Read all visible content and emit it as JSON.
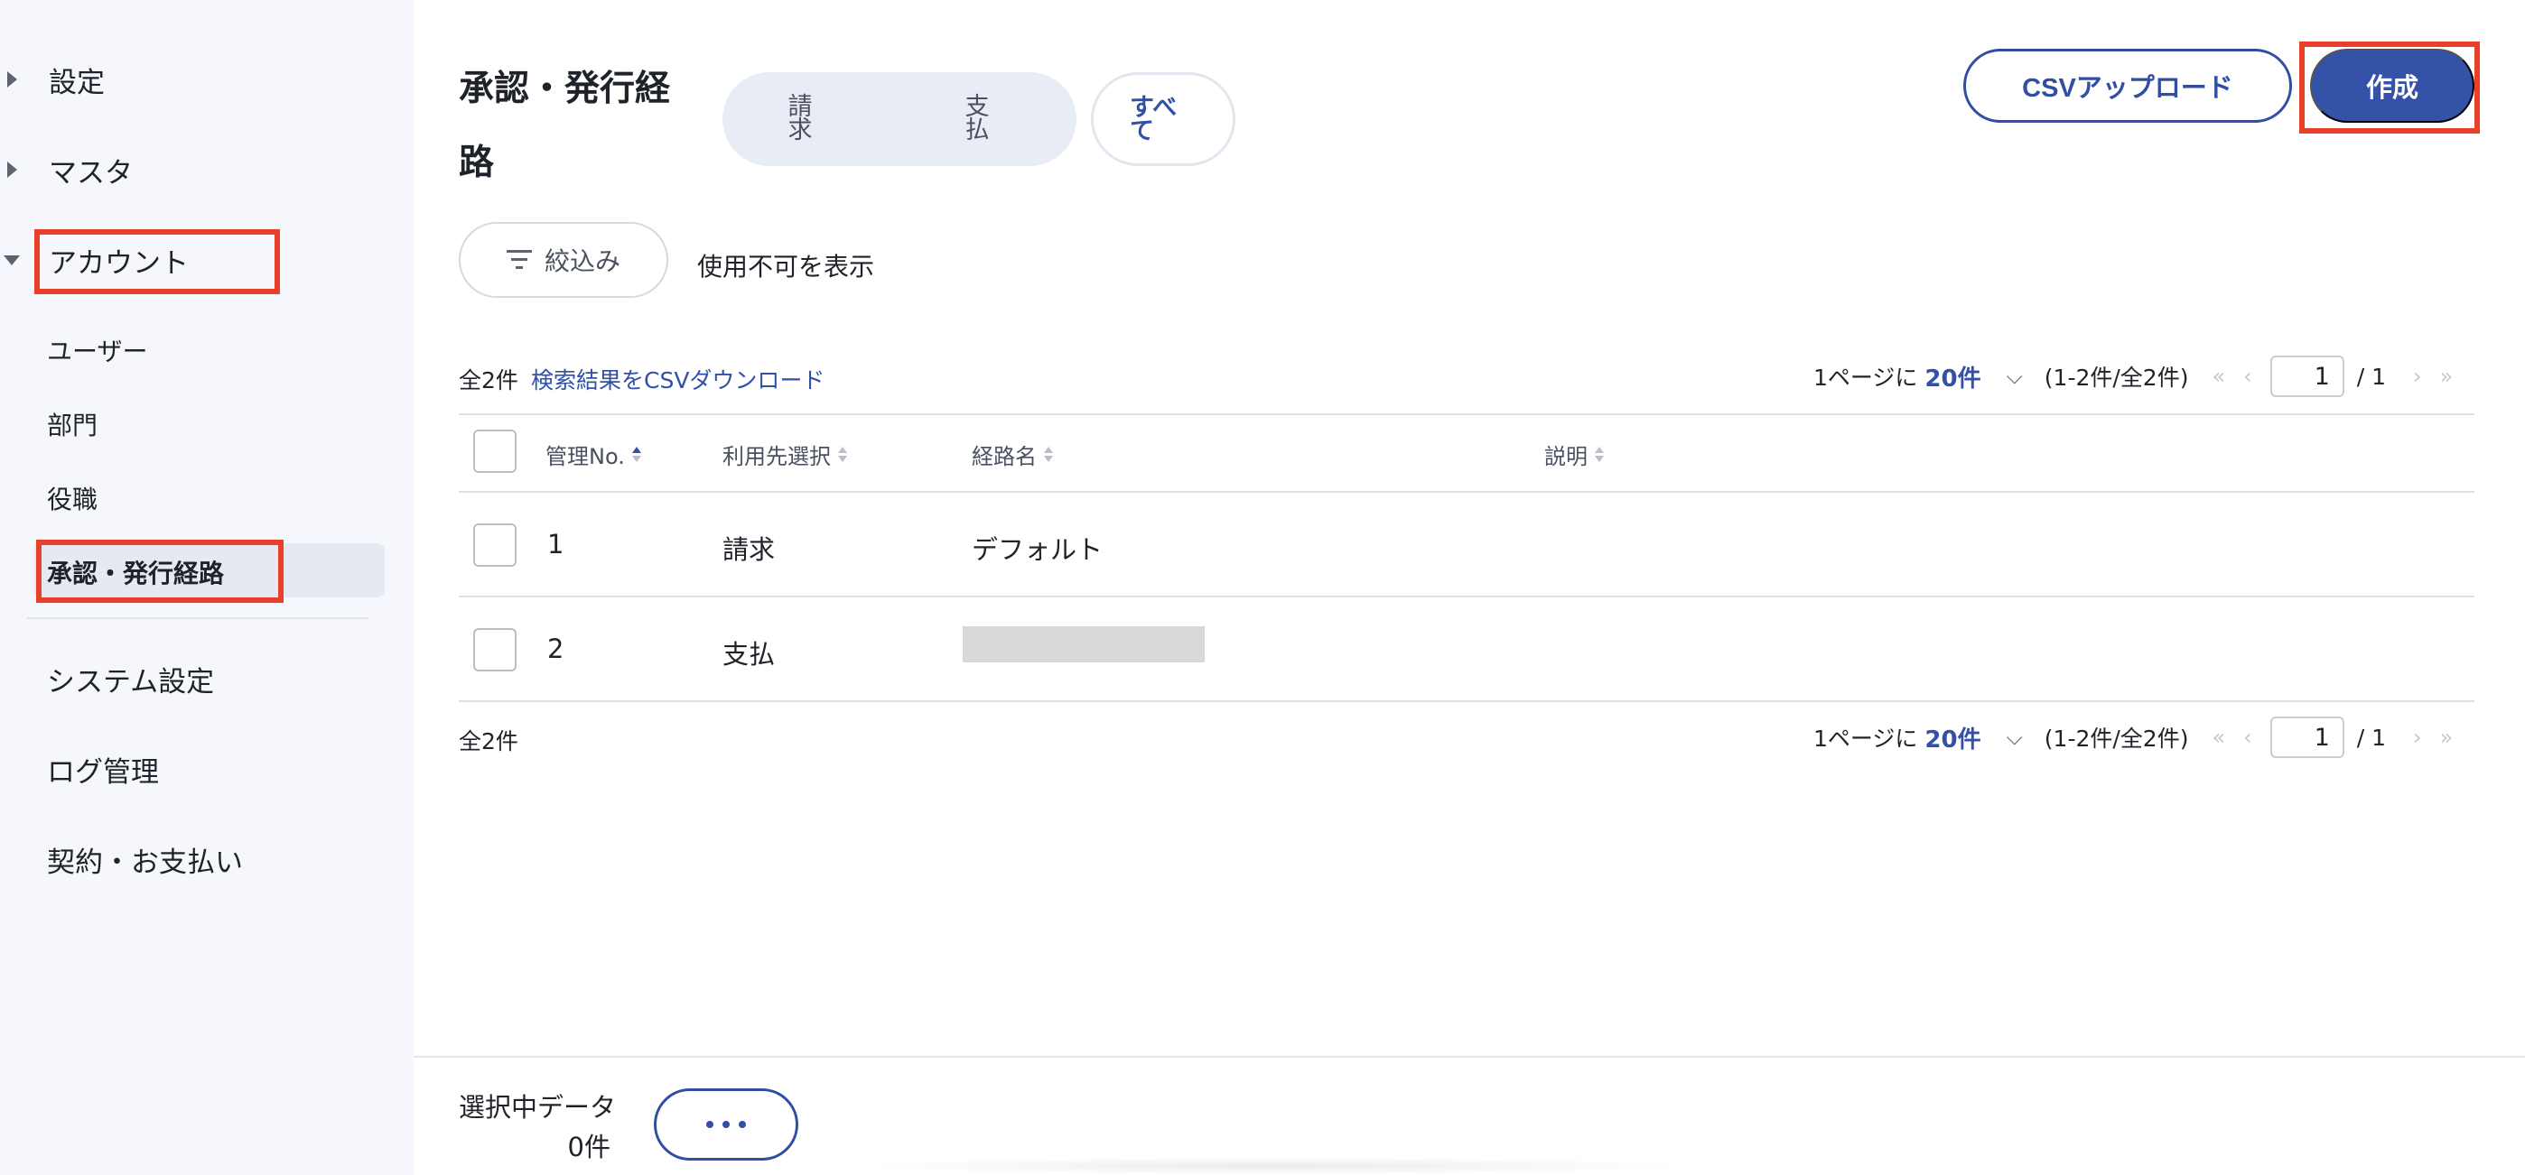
{
  "sidebar": {
    "groups": [
      {
        "label": "設定"
      },
      {
        "label": "マスタ"
      },
      {
        "label": "アカウント"
      }
    ],
    "account_items": [
      {
        "label": "ユーザー"
      },
      {
        "label": "部門"
      },
      {
        "label": "役職"
      },
      {
        "label": "承認・発行経路"
      }
    ],
    "bottom_items": [
      {
        "label": "システム設定"
      },
      {
        "label": "ログ管理"
      },
      {
        "label": "契約・お支払い"
      }
    ]
  },
  "header": {
    "title": "承認・発行経路",
    "segments": {
      "billing": "請求",
      "payment": "支払",
      "all": "すべて"
    },
    "csv_upload": "CSVアップロード",
    "create": "作成"
  },
  "filter": {
    "button": "絞込み",
    "show_disabled": "使用不可を表示"
  },
  "table": {
    "total_top": "全2件",
    "csv_download": "検索結果をCSVダウンロード",
    "total_bottom": "全2件",
    "columns": {
      "no": "管理No.",
      "target": "利用先選択",
      "route": "経路名",
      "desc": "説明"
    },
    "rows": [
      {
        "no": "1",
        "target": "請求",
        "route": "デフォルト",
        "desc": ""
      },
      {
        "no": "2",
        "target": "支払",
        "route": "",
        "desc": ""
      }
    ]
  },
  "pager": {
    "per_page_label": "1ページに",
    "per_page": "20件",
    "range": "(1-2件/全2件)",
    "page": "1",
    "total_pages": "/ 1"
  },
  "footer": {
    "selected_label": "選択中データ",
    "selected_count": "0件"
  },
  "icons": {
    "caret_collapsed": "caret-right-icon",
    "caret_expanded": "caret-down-icon",
    "filter": "filter-icon",
    "sort": "sort-icon",
    "more": "more-dots-icon"
  },
  "colors": {
    "accent": "#3452a8",
    "highlight": "#e8402a",
    "sidebar_bg": "#f5f7fc"
  }
}
